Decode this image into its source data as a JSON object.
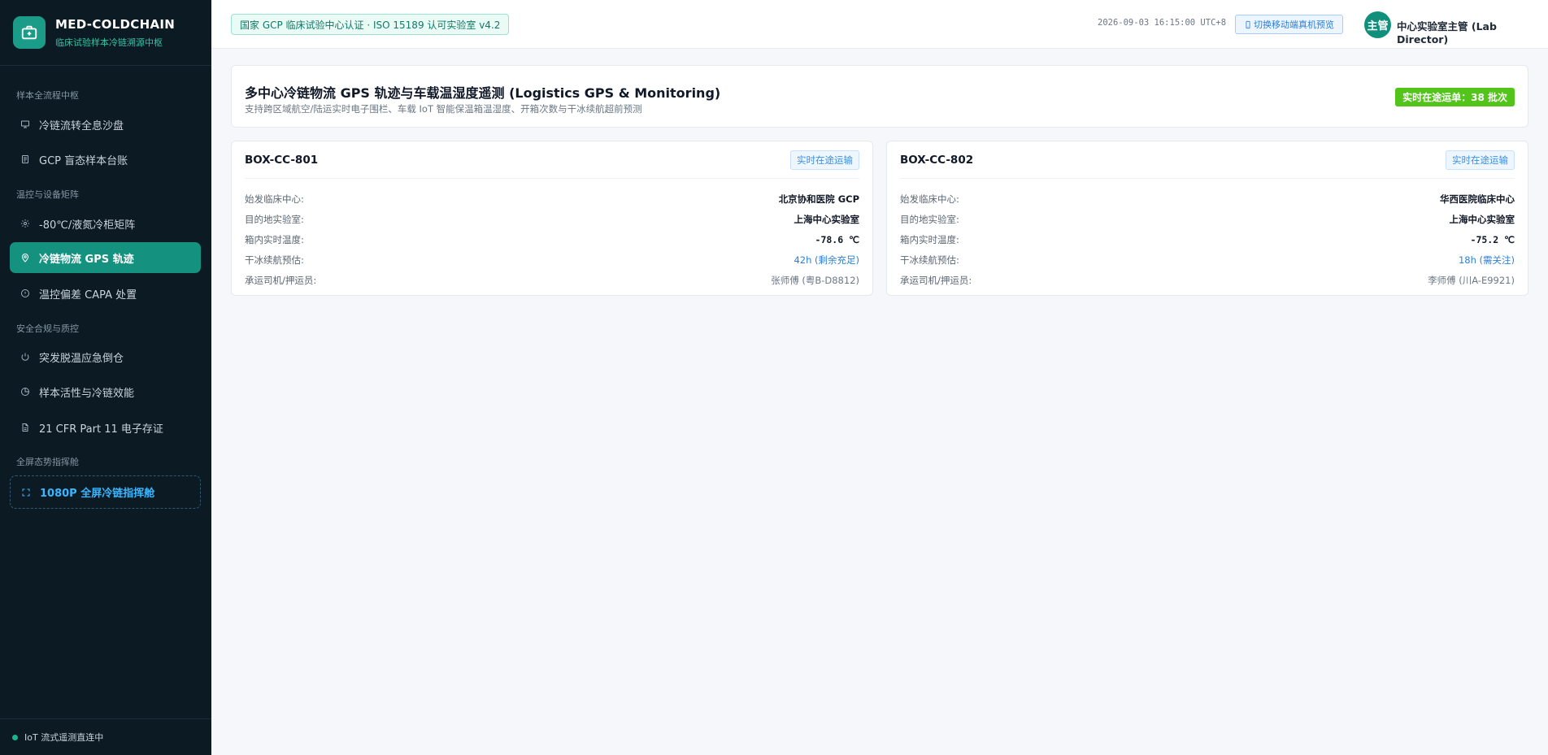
{
  "brand": {
    "name": "MED-COLDCHAIN",
    "subtitle": "临床试验样本冷链溯源中枢"
  },
  "sidebar": {
    "groups": [
      {
        "title": "样本全流程中枢",
        "items": [
          {
            "label": "冷链流转全息沙盘",
            "icon": "monitor-icon"
          },
          {
            "label": "GCP 盲态样本台账",
            "icon": "document-icon"
          }
        ]
      },
      {
        "title": "温控与设备矩阵",
        "items": [
          {
            "label": "-80℃/液氮冷柜矩阵",
            "icon": "gear-icon"
          },
          {
            "label": "冷链物流 GPS 轨迹",
            "icon": "location-pin-icon",
            "active": true
          },
          {
            "label": "温控偏差 CAPA 处置",
            "icon": "info-circle-icon"
          }
        ]
      },
      {
        "title": "安全合规与质控",
        "items": [
          {
            "label": "突发脱温应急倒仓",
            "icon": "power-icon"
          },
          {
            "label": "样本活性与冷链效能",
            "icon": "pie-chart-icon"
          },
          {
            "label": "21 CFR Part 11 电子存证",
            "icon": "file-icon"
          }
        ]
      },
      {
        "title": "全屏态势指挥舱",
        "items": [
          {
            "label": "1080P 全屏冷链指挥舱",
            "icon": "fullscreen-icon"
          }
        ]
      }
    ],
    "footer": "IoT 流式遥测直连中",
    "colors": {
      "bg": "#0c1a24",
      "active": "#14917f",
      "accent": "#3ab6ff"
    }
  },
  "header": {
    "cert": "国家 GCP 临床试验中心认证 · ISO 15189 认可实验室 v4.2",
    "datetime": "2026-09-03 16:15:00 UTC+8",
    "mobile_button": "切换移动端真机预览",
    "avatar_text": "主管",
    "user": "中心实验室主管 (Lab Director)"
  },
  "main": {
    "title": "多中心冷链物流 GPS 轨迹与车载温湿度遥测 (Logistics GPS & Monitoring)",
    "subtitle": "支持跨区域航空/陆运实时电子围栏、车载 IoT 智能保温箱温湿度、开箱次数与干冰续航超前预测",
    "transit_badge": "实时在途运单：38 批次",
    "labels": {
      "origin": "始发临床中心:",
      "destination": "目的地实验室:",
      "temperature": "箱内实时温度:",
      "dry_ice": "干冰续航预估:",
      "driver": "承运司机/押运员:"
    },
    "shipments": [
      {
        "id": "BOX-CC-801",
        "status": "实时在途运输",
        "origin": "北京协和医院 GCP",
        "destination": "上海中心实验室",
        "temperature": "-78.6 ℃",
        "dry_ice": "42h (剩余充足)",
        "driver": "张师傅 (粤B-D8812)"
      },
      {
        "id": "BOX-CC-802",
        "status": "实时在途运输",
        "origin": "华西医院临床中心",
        "destination": "上海中心实验室",
        "temperature": "-75.2 ℃",
        "dry_ice": "18h (需关注)",
        "driver": "李师傅 (川A-E9921)"
      }
    ]
  }
}
